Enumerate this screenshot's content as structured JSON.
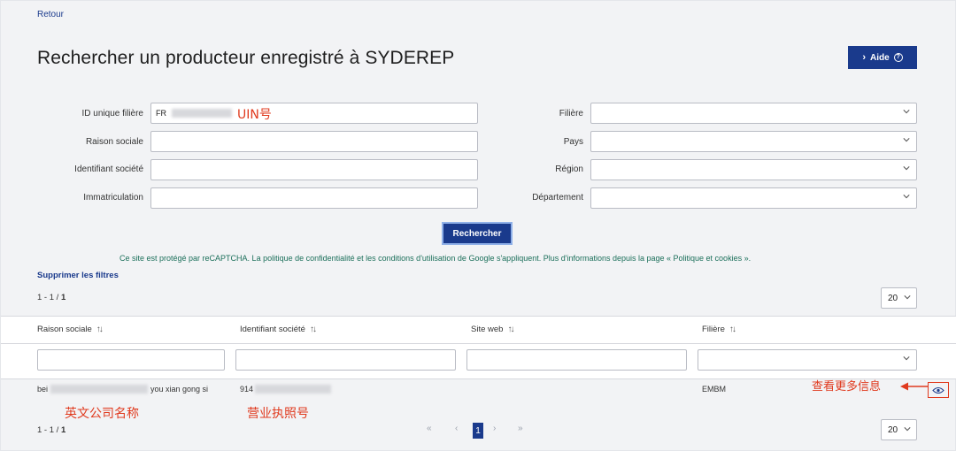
{
  "nav": {
    "back_label": "Retour"
  },
  "header": {
    "title": "Rechercher un producteur enregistré à SYDEREP",
    "help_label": "Aide"
  },
  "form": {
    "left_fields": [
      {
        "label": "ID unique filière",
        "value": "FR"
      },
      {
        "label": "Raison sociale",
        "value": ""
      },
      {
        "label": "Identifiant société",
        "value": ""
      },
      {
        "label": "Immatriculation",
        "value": ""
      }
    ],
    "right_fields": [
      {
        "label": "Filière",
        "value": ""
      },
      {
        "label": "Pays",
        "value": ""
      },
      {
        "label": "Région",
        "value": ""
      },
      {
        "label": "Département",
        "value": ""
      }
    ],
    "search_label": "Rechercher",
    "captcha_note": "Ce site est protégé par reCAPTCHA. La politique de confidentialité et les conditions d'utilisation de Google s'appliquent. Plus d'informations depuis la page « Politique et cookies ».",
    "clear_filters_label": "Supprimer les filtres"
  },
  "results": {
    "count_top_prefix": "1 - 1 / ",
    "count_top_total": "1",
    "count_bottom_prefix": "1 - 1 / ",
    "count_bottom_total": "1",
    "page_size": "20",
    "columns": [
      "Raison sociale",
      "Identifiant société",
      "Site web",
      "Filière"
    ],
    "rows": [
      {
        "raison_sociale_start": "bei",
        "raison_sociale_end": "you xian gong si",
        "identifiant_start": "914",
        "site_web": "",
        "filiere": "EMBM"
      }
    ]
  },
  "pagination": {
    "first": "«",
    "prev": "‹",
    "current": "1",
    "next": "›",
    "last": "»"
  },
  "annotations": {
    "uin": "UIN号",
    "company_name": "英文公司名称",
    "business_license": "营业执照号",
    "more_info": "查看更多信息"
  },
  "colors": {
    "primary": "#1a3a8c",
    "annotation": "#e03a1e",
    "captcha_text": "#1b6f5a"
  },
  "icons": {
    "help": "question-circle-icon",
    "dropdown": "chevron-down-icon",
    "sort": "sort-arrows-icon",
    "details": "eye-icon"
  }
}
